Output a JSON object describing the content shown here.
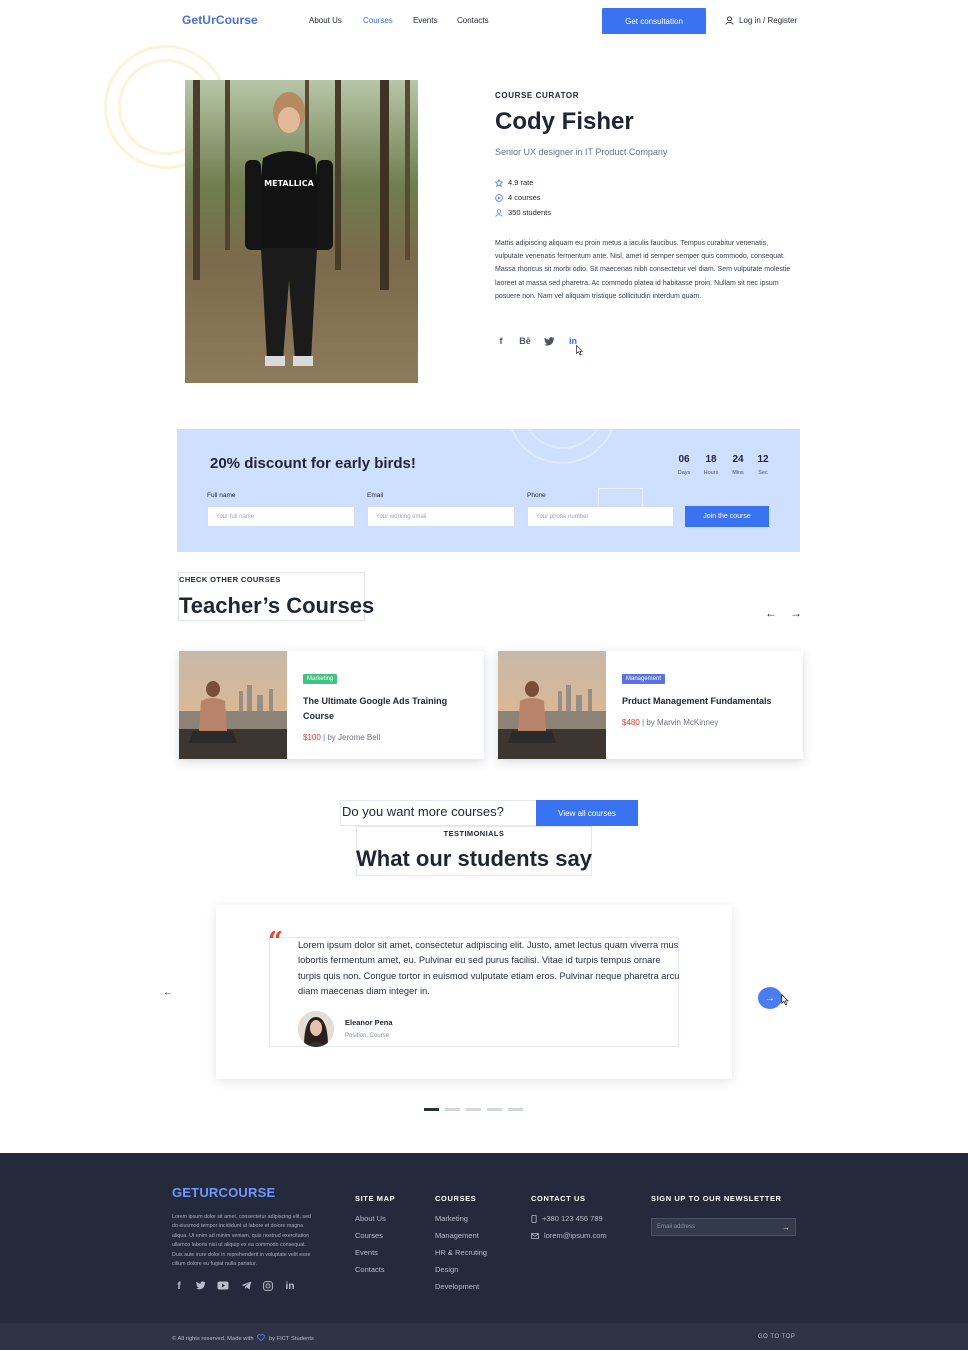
{
  "header": {
    "logo": "GetUrCourse",
    "nav": [
      "About Us",
      "Courses",
      "Events",
      "Contacts"
    ],
    "active_nav": "Courses",
    "cta": "Get consultation",
    "login": "Log in / Register"
  },
  "curator": {
    "kicker": "COURSE CURATOR",
    "name": "Cody Fisher",
    "role": "Senior UX designer in IT Product Company",
    "stats": {
      "rate": "4.9 rate",
      "courses": "4 courses",
      "students": "350 students"
    },
    "bio": "Mattis adipiscing aliquam eu proin metus a iaculis faucibus. Tempus curabitur venenatis, vulputate venenatis fermentum ante. Nisl, amet id semper semper quis commodo, consequat. Massa rhoncus sit morbi odio. Sit maecenas nibh consectetur vel diam. Sem vulputate molestie laoreet at massa sed pharetra. Ac commodo platea id habitasse proin. Nullam sit nec ipsum posuere non. Nam vel aliquam tristique sollicitudin interdum quam.",
    "photo_shirt_text": "METALLICA",
    "social": {
      "facebook": "f",
      "behance": "Bē",
      "twitter": "twitter-icon",
      "linkedin": "in"
    }
  },
  "discount": {
    "title": "20% discount for early birds!",
    "countdown": [
      {
        "value": "06",
        "label": "Days"
      },
      {
        "value": "18",
        "label": "Hours"
      },
      {
        "value": "24",
        "label": "Mins"
      },
      {
        "value": "12",
        "label": "Sec"
      }
    ],
    "fields": [
      {
        "label": "Full name",
        "placeholder": "Your full name"
      },
      {
        "label": "Email",
        "placeholder": "Your working email"
      },
      {
        "label": "Phone",
        "placeholder": "Your phone number"
      }
    ],
    "submit": "Join the course"
  },
  "teacher_courses": {
    "kicker": "CHECK OTHER COURSES",
    "title": "Teacher’s Courses",
    "prev": "←",
    "next": "→",
    "cards": [
      {
        "tag": "Marketing",
        "tag_color": "#3fc47f",
        "title": "The Ultimate Google Ads Training Course",
        "price": "$100",
        "author": "| by Jerome Bell"
      },
      {
        "tag": "Management",
        "tag_color": "#5a72e6",
        "title": "Prduct Management Fundamentals",
        "price": "$480",
        "author": "| by Marvin McKinney"
      }
    ]
  },
  "more": {
    "question": "Do you want more courses?",
    "button": "View all courses"
  },
  "testimonials": {
    "kicker": "TESTIMONIALS",
    "title": "What our students say",
    "quote_mark": "“",
    "text": "Lorem ipsum dolor sit amet, consectetur adipiscing elit. Justo, amet lectus quam viverra mus lobortis fermentum amet, eu. Pulvinar eu sed purus facilisi. Vitae id turpis tempus ornare turpis quis non. Congue tortor in euismod vulputate etiam eros. Pulvinar neque pharetra arcu diam maecenas diam integer in.",
    "name": "Eleanor Pena",
    "position": "Position, Course",
    "prev": "←",
    "next": "→",
    "active_slide": 1,
    "total_slides": 5
  },
  "footer": {
    "logo": "GETURCOURSE",
    "about": "Lorem ipsum dolor sit amet, consectetur adipiscing elit, sed do eiusmod tempor incididunt ut labore et dolore magna aliqua. Ut enim ad minim veniam, quis nostrud exercitation ullamco laboris nisi ut aliquip ex ea commodo consequat. Duis aute irure dolor in reprehenderit in voluptate velit esse cillum dolore eu fugiat nulla pariatur.",
    "sitemap_title": "SITE MAP",
    "sitemap": [
      "About Us",
      "Courses",
      "Events",
      "Contacts"
    ],
    "courses_title": "COURSES",
    "courses": [
      "Marketing",
      "Management",
      "HR & Recruting",
      "Design",
      "Development"
    ],
    "contact_title": "CONTACT US",
    "phone": "+380 123 456 789",
    "email": "lorem@ipsum.com",
    "newsletter_title": "SIGN UP TO OUR NEWSLETTER",
    "newsletter_placeholder": "Email address",
    "newsletter_submit": "→",
    "copyright_pre": "© All rights reserved. Made with",
    "copyright_post": "by FICT Students",
    "goto_top": "GO TO TOP"
  }
}
